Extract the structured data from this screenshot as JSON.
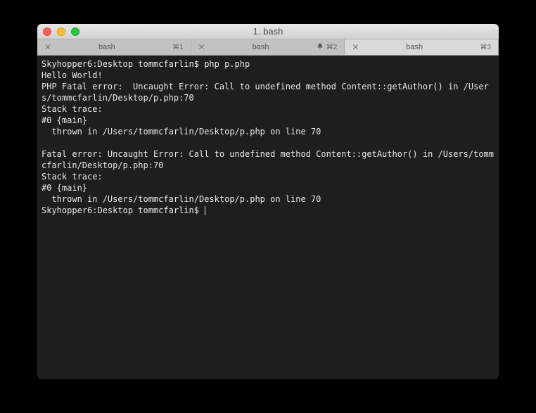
{
  "window": {
    "title": "1. bash"
  },
  "tabs": [
    {
      "label": "bash",
      "shortcut": "⌘1",
      "bell": false,
      "active": false
    },
    {
      "label": "bash",
      "shortcut": "⌘2",
      "bell": true,
      "active": false
    },
    {
      "label": "bash",
      "shortcut": "⌘3",
      "bell": false,
      "active": true
    }
  ],
  "terminal": {
    "lines": [
      "Skyhopper6:Desktop tommcfarlin$ php p.php",
      "Hello World!",
      "PHP Fatal error:  Uncaught Error: Call to undefined method Content::getAuthor() in /Users/tommcfarlin/Desktop/p.php:70",
      "Stack trace:",
      "#0 {main}",
      "  thrown in /Users/tommcfarlin/Desktop/p.php on line 70",
      "",
      "Fatal error: Uncaught Error: Call to undefined method Content::getAuthor() in /Users/tommcfarlin/Desktop/p.php:70",
      "Stack trace:",
      "#0 {main}",
      "  thrown in /Users/tommcfarlin/Desktop/p.php on line 70"
    ],
    "prompt": "Skyhopper6:Desktop tommcfarlin$ "
  }
}
